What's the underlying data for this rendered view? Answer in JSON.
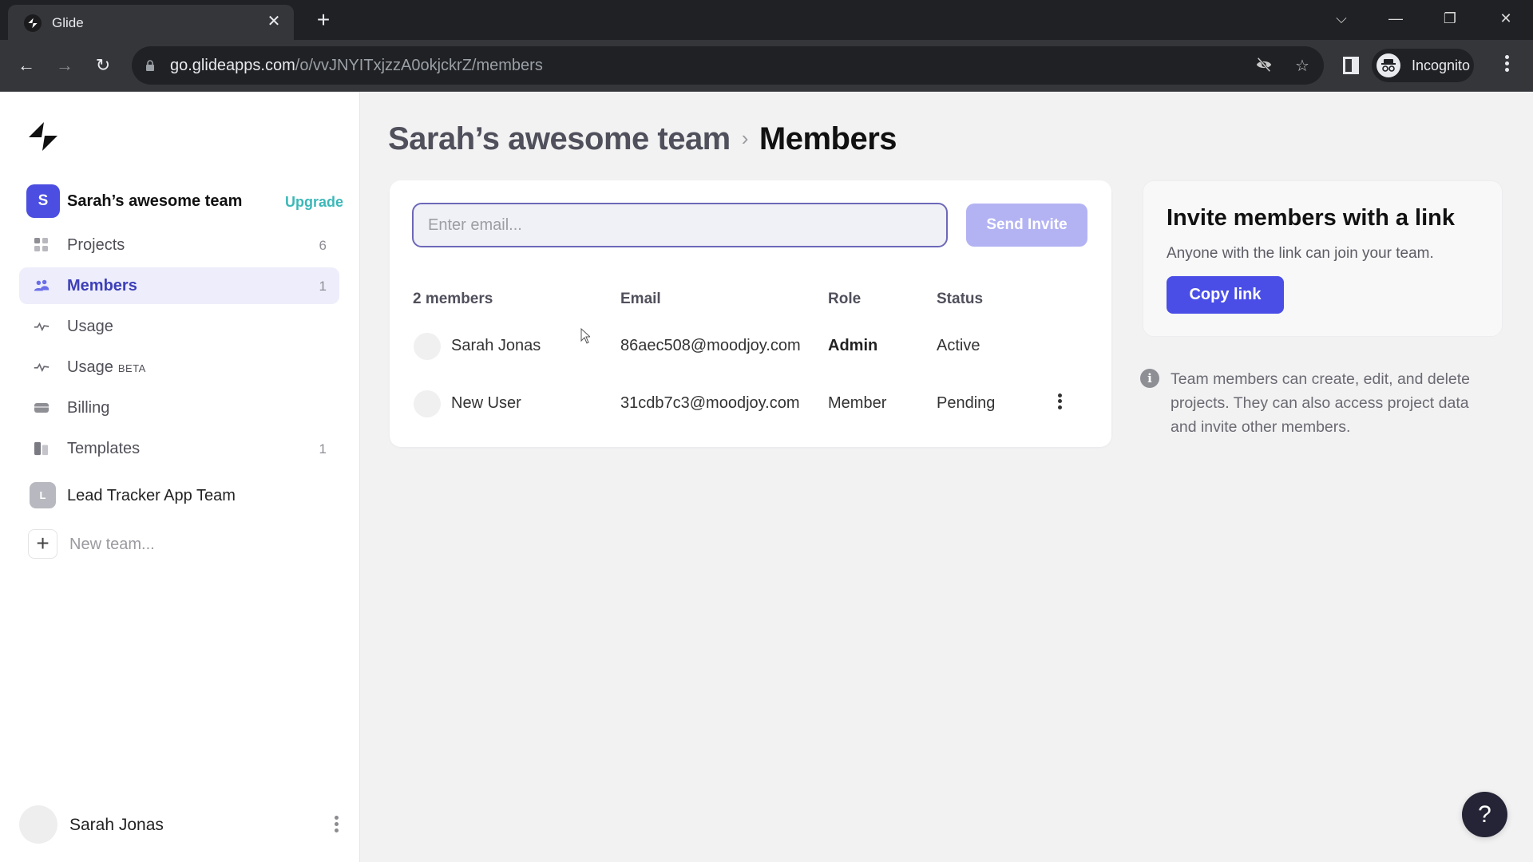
{
  "browser": {
    "tab_title": "Glide",
    "url_host": "go.glideapps.com",
    "url_path": "/o/vvJNYITxjzzA0okjckrZ/members",
    "profile_label": "Incognito"
  },
  "sidebar": {
    "team": {
      "initial": "S",
      "name": "Sarah’s awesome team",
      "upgrade_label": "Upgrade"
    },
    "items": [
      {
        "label": "Projects",
        "count": "6",
        "icon": "grid-icon"
      },
      {
        "label": "Members",
        "count": "1",
        "icon": "users-icon",
        "active": true
      },
      {
        "label": "Usage",
        "count": "",
        "icon": "activity-icon"
      },
      {
        "label": "Usage",
        "badge": "BETA",
        "count": "",
        "icon": "activity-icon"
      },
      {
        "label": "Billing",
        "count": "",
        "icon": "credit-card-icon"
      },
      {
        "label": "Templates",
        "count": "1",
        "icon": "templates-icon"
      }
    ],
    "other_team": {
      "initial": "L",
      "name": "Lead Tracker App Team"
    },
    "new_team_label": "New team...",
    "user": {
      "name": "Sarah Jonas"
    }
  },
  "main": {
    "breadcrumb": {
      "parent": "Sarah’s awesome team",
      "separator": "›",
      "current": "Members"
    },
    "invite": {
      "placeholder": "Enter email...",
      "value": "",
      "send_label": "Send Invite"
    },
    "table": {
      "headers": [
        "2 members",
        "Email",
        "Role",
        "Status"
      ],
      "rows": [
        {
          "name": "Sarah Jonas",
          "email": "86aec508@moodjoy.com",
          "role": "Admin",
          "status": "Active",
          "has_menu": false
        },
        {
          "name": "New User",
          "email": "31cdb7c3@moodjoy.com",
          "role": "Member",
          "status": "Pending",
          "has_menu": true
        }
      ]
    },
    "link_card": {
      "title": "Invite members with a link",
      "subtitle": "Anyone with the link can join your team.",
      "button_label": "Copy link"
    },
    "info_text": "Team members can create, edit, and delete projects. They can also access project data and invite other members.",
    "help_label": "?"
  },
  "colors": {
    "accent": "#4a4ee6",
    "accent_disabled": "#b3b3f4",
    "upgrade": "#3cb8b8",
    "active_nav_bg": "#ededfb"
  }
}
